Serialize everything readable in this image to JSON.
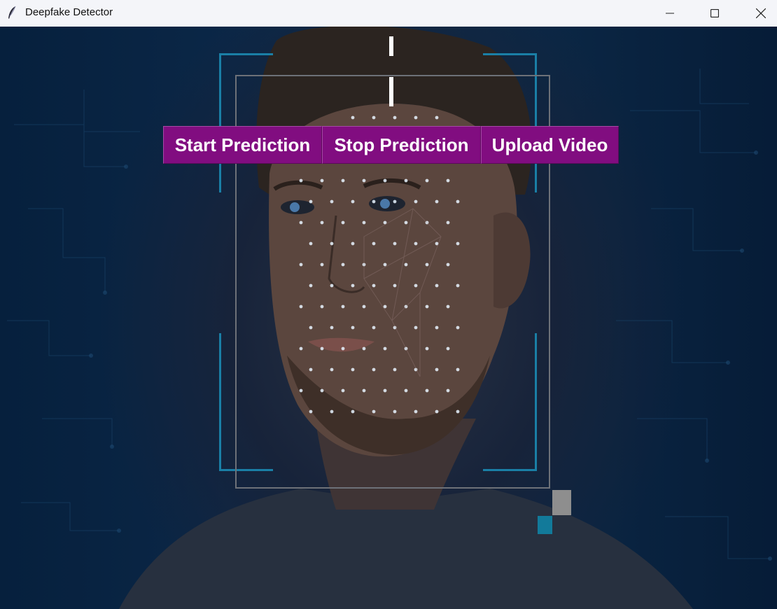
{
  "window": {
    "title": "Deepfake Detector",
    "app_icon": "feather-icon",
    "controls": {
      "minimize": "minimize-icon",
      "maximize": "maximize-icon",
      "close": "close-icon"
    }
  },
  "toolbar": {
    "start_label": "Start Prediction",
    "stop_label": "Stop Prediction",
    "upload_label": "Upload Video"
  },
  "colors": {
    "button_bg": "#810d80",
    "button_text": "#ffffff",
    "hud_accent": "#1a7fa6",
    "background": "#0b2747"
  }
}
